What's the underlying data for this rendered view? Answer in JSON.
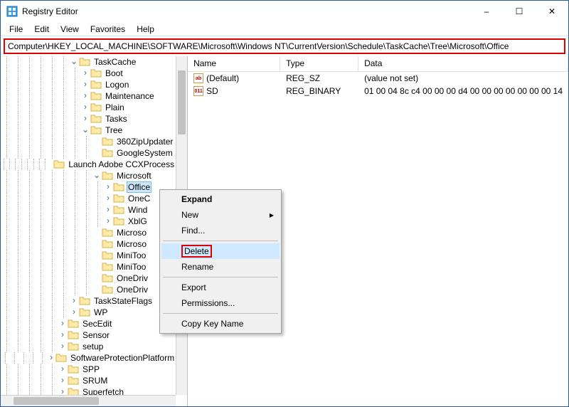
{
  "window": {
    "title": "Registry Editor",
    "controls": {
      "min": "–",
      "max": "☐",
      "close": "✕"
    }
  },
  "menubar": [
    "File",
    "Edit",
    "View",
    "Favorites",
    "Help"
  ],
  "addressbar": "Computer\\HKEY_LOCAL_MACHINE\\SOFTWARE\\Microsoft\\Windows NT\\CurrentVersion\\Schedule\\TaskCache\\Tree\\Microsoft\\Office",
  "tree": {
    "nodes": [
      {
        "depth": 6,
        "toggle": "v",
        "label": "TaskCache"
      },
      {
        "depth": 7,
        "toggle": ">",
        "label": "Boot"
      },
      {
        "depth": 7,
        "toggle": ">",
        "label": "Logon"
      },
      {
        "depth": 7,
        "toggle": ">",
        "label": "Maintenance"
      },
      {
        "depth": 7,
        "toggle": ">",
        "label": "Plain"
      },
      {
        "depth": 7,
        "toggle": ">",
        "label": "Tasks"
      },
      {
        "depth": 7,
        "toggle": "v",
        "label": "Tree"
      },
      {
        "depth": 8,
        "toggle": "",
        "label": "360ZipUpdater"
      },
      {
        "depth": 8,
        "toggle": "",
        "label": "GoogleSystem"
      },
      {
        "depth": 8,
        "toggle": "",
        "label": "Launch Adobe CCXProcess"
      },
      {
        "depth": 8,
        "toggle": "v",
        "label": "Microsoft"
      },
      {
        "depth": 9,
        "toggle": ">",
        "label": "Office",
        "selected": true
      },
      {
        "depth": 9,
        "toggle": ">",
        "label": "OneC"
      },
      {
        "depth": 9,
        "toggle": ">",
        "label": "Wind"
      },
      {
        "depth": 9,
        "toggle": ">",
        "label": "XblG"
      },
      {
        "depth": 8,
        "toggle": "",
        "label": "Microso"
      },
      {
        "depth": 8,
        "toggle": "",
        "label": "Microso"
      },
      {
        "depth": 8,
        "toggle": "",
        "label": "MiniToo"
      },
      {
        "depth": 8,
        "toggle": "",
        "label": "MiniToo"
      },
      {
        "depth": 8,
        "toggle": "",
        "label": "OneDriv"
      },
      {
        "depth": 8,
        "toggle": "",
        "label": "OneDriv"
      },
      {
        "depth": 6,
        "toggle": ">",
        "label": "TaskStateFlags"
      },
      {
        "depth": 6,
        "toggle": ">",
        "label": "WP"
      },
      {
        "depth": 5,
        "toggle": ">",
        "label": "SecEdit"
      },
      {
        "depth": 5,
        "toggle": ">",
        "label": "Sensor"
      },
      {
        "depth": 5,
        "toggle": ">",
        "label": "setup"
      },
      {
        "depth": 5,
        "toggle": ">",
        "label": "SoftwareProtectionPlatform"
      },
      {
        "depth": 5,
        "toggle": ">",
        "label": "SPP"
      },
      {
        "depth": 5,
        "toggle": ">",
        "label": "SRUM"
      },
      {
        "depth": 5,
        "toggle": ">",
        "label": "Superfetch"
      }
    ]
  },
  "list": {
    "columns": {
      "name": "Name",
      "type": "Type",
      "data": "Data"
    },
    "rows": [
      {
        "icon": "ab",
        "name": "(Default)",
        "type": "REG_SZ",
        "data": "(value not set)"
      },
      {
        "icon": "011",
        "name": "SD",
        "type": "REG_BINARY",
        "data": "01 00 04 8c c4 00 00 00 d4 00 00 00 00 00 00 00 14"
      }
    ]
  },
  "context_menu": {
    "items": [
      {
        "label": "Expand",
        "bold": true
      },
      {
        "label": "New",
        "submenu": true
      },
      {
        "label": "Find..."
      },
      {
        "sep": true
      },
      {
        "label": "Delete",
        "highlight": true,
        "boxed": true
      },
      {
        "label": "Rename"
      },
      {
        "sep": true
      },
      {
        "label": "Export"
      },
      {
        "label": "Permissions..."
      },
      {
        "sep": true
      },
      {
        "label": "Copy Key Name"
      }
    ]
  }
}
